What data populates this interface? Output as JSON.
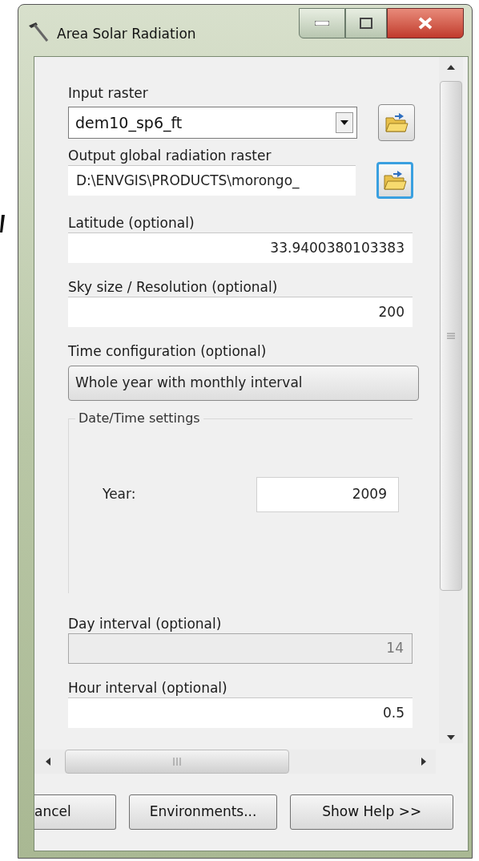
{
  "window": {
    "title": "Area Solar Radiation"
  },
  "parameters": [
    {
      "kind": "combo",
      "label": "Input raster",
      "value": "dem10_sp6_ft",
      "browse": true,
      "browse_focused": false
    },
    {
      "kind": "path",
      "label": "Output global radiation raster",
      "value": "D:\\ENVGIS\\PRODUCTS\\morongo_",
      "browse": true,
      "browse_focused": true
    },
    {
      "kind": "text",
      "label": "Latitude (optional)",
      "value": "33.9400380103383"
    },
    {
      "kind": "text",
      "label": "Sky size / Resolution (optional)",
      "value": "200"
    },
    {
      "kind": "select",
      "label": "Time configuration (optional)",
      "value": "Whole year with monthly interval"
    },
    {
      "kind": "group",
      "label": "Date/Time settings",
      "fields": [
        {
          "label": "Year:",
          "value": "2009"
        }
      ]
    },
    {
      "kind": "text",
      "label": "Day interval (optional)",
      "value": "14",
      "disabled": true
    },
    {
      "kind": "text",
      "label": "Hour interval (optional)",
      "value": "0.5",
      "disabled": false
    }
  ],
  "buttons": [
    "ancel",
    "Environments...",
    "Show Help >>"
  ]
}
